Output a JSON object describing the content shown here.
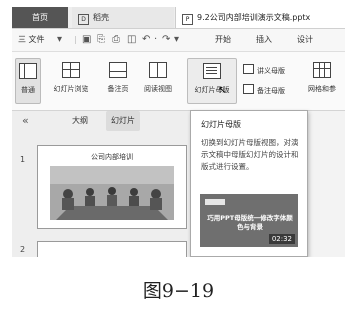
{
  "tabs": [
    {
      "label": "首页"
    },
    {
      "label": "稻壳"
    },
    {
      "label": "9.2公司内部培训演示文稿.pptx"
    }
  ],
  "menu": {
    "file": "三 文件",
    "start": "开始",
    "insert": "插入",
    "design": "设计"
  },
  "ribbon": {
    "normal": "普通",
    "slide_browse": "幻灯片浏览",
    "notes_page": "备注页",
    "reading_view": "阅读视图",
    "slide_master": "幻灯片母版",
    "handout_master": "讲义母版",
    "notes_master": "备注母版",
    "grid": "网格和参"
  },
  "panel": {
    "collapse": "«",
    "outline_tab": "大纲",
    "slides_tab": "幻灯片",
    "slides": [
      {
        "number": "1",
        "title": "公司内部培训"
      },
      {
        "number": "2"
      }
    ]
  },
  "tooltip": {
    "title": "幻灯片母版",
    "description": "切换到幻灯片母版视图，对演示文稿中母版幻灯片的设计和版式进行设置。",
    "video_text": "巧用PPT母版统一修改字体颜色与背景",
    "duration": "02:32"
  },
  "caption": "图9−19",
  "colors": {
    "home_tab": "#555555",
    "selected_button": "#e2e2e2",
    "panel_bg": "#eeeeee"
  }
}
